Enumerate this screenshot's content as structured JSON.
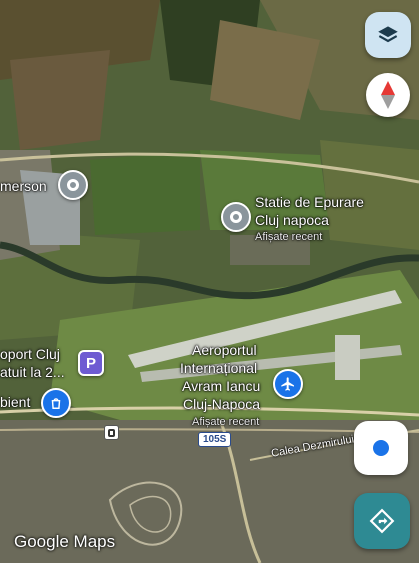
{
  "map": {
    "places": [
      {
        "name": "merson"
      },
      {
        "name": "Statie de Epurare",
        "name2": "Cluj napoca",
        "status": "Afișate recent"
      },
      {
        "name": "oport Cluj",
        "name2": "atuit la 2..."
      },
      {
        "name": "Aeroportul",
        "name2": "Internațional",
        "name3": "Avram Iancu",
        "name4": "Cluj-Napoca",
        "status": "Afișate recent"
      },
      {
        "name": "bient"
      }
    ],
    "roads": {
      "shield": "105S",
      "street": "Calea Dezmirului"
    }
  },
  "watermark": "Google Maps",
  "controls": {
    "layers_icon": "layers-icon",
    "compass_icon": "compass-icon",
    "location_icon": "my-location-icon",
    "directions_icon": "directions-icon"
  },
  "colors": {
    "accent_blue": "#1a73e8",
    "directions_teal": "#2e8a93",
    "parking_purple": "#6e5bd2",
    "pin_gray": "#8a959c"
  }
}
